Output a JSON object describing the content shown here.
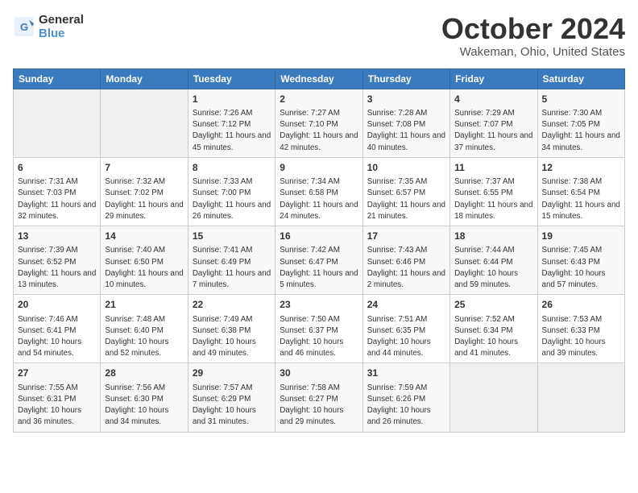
{
  "header": {
    "logo_line1": "General",
    "logo_line2": "Blue",
    "month_title": "October 2024",
    "location": "Wakeman, Ohio, United States"
  },
  "weekdays": [
    "Sunday",
    "Monday",
    "Tuesday",
    "Wednesday",
    "Thursday",
    "Friday",
    "Saturday"
  ],
  "weeks": [
    [
      {
        "day": "",
        "info": ""
      },
      {
        "day": "",
        "info": ""
      },
      {
        "day": "1",
        "info": "Sunrise: 7:26 AM\nSunset: 7:12 PM\nDaylight: 11 hours and 45 minutes."
      },
      {
        "day": "2",
        "info": "Sunrise: 7:27 AM\nSunset: 7:10 PM\nDaylight: 11 hours and 42 minutes."
      },
      {
        "day": "3",
        "info": "Sunrise: 7:28 AM\nSunset: 7:08 PM\nDaylight: 11 hours and 40 minutes."
      },
      {
        "day": "4",
        "info": "Sunrise: 7:29 AM\nSunset: 7:07 PM\nDaylight: 11 hours and 37 minutes."
      },
      {
        "day": "5",
        "info": "Sunrise: 7:30 AM\nSunset: 7:05 PM\nDaylight: 11 hours and 34 minutes."
      }
    ],
    [
      {
        "day": "6",
        "info": "Sunrise: 7:31 AM\nSunset: 7:03 PM\nDaylight: 11 hours and 32 minutes."
      },
      {
        "day": "7",
        "info": "Sunrise: 7:32 AM\nSunset: 7:02 PM\nDaylight: 11 hours and 29 minutes."
      },
      {
        "day": "8",
        "info": "Sunrise: 7:33 AM\nSunset: 7:00 PM\nDaylight: 11 hours and 26 minutes."
      },
      {
        "day": "9",
        "info": "Sunrise: 7:34 AM\nSunset: 6:58 PM\nDaylight: 11 hours and 24 minutes."
      },
      {
        "day": "10",
        "info": "Sunrise: 7:35 AM\nSunset: 6:57 PM\nDaylight: 11 hours and 21 minutes."
      },
      {
        "day": "11",
        "info": "Sunrise: 7:37 AM\nSunset: 6:55 PM\nDaylight: 11 hours and 18 minutes."
      },
      {
        "day": "12",
        "info": "Sunrise: 7:38 AM\nSunset: 6:54 PM\nDaylight: 11 hours and 15 minutes."
      }
    ],
    [
      {
        "day": "13",
        "info": "Sunrise: 7:39 AM\nSunset: 6:52 PM\nDaylight: 11 hours and 13 minutes."
      },
      {
        "day": "14",
        "info": "Sunrise: 7:40 AM\nSunset: 6:50 PM\nDaylight: 11 hours and 10 minutes."
      },
      {
        "day": "15",
        "info": "Sunrise: 7:41 AM\nSunset: 6:49 PM\nDaylight: 11 hours and 7 minutes."
      },
      {
        "day": "16",
        "info": "Sunrise: 7:42 AM\nSunset: 6:47 PM\nDaylight: 11 hours and 5 minutes."
      },
      {
        "day": "17",
        "info": "Sunrise: 7:43 AM\nSunset: 6:46 PM\nDaylight: 11 hours and 2 minutes."
      },
      {
        "day": "18",
        "info": "Sunrise: 7:44 AM\nSunset: 6:44 PM\nDaylight: 10 hours and 59 minutes."
      },
      {
        "day": "19",
        "info": "Sunrise: 7:45 AM\nSunset: 6:43 PM\nDaylight: 10 hours and 57 minutes."
      }
    ],
    [
      {
        "day": "20",
        "info": "Sunrise: 7:46 AM\nSunset: 6:41 PM\nDaylight: 10 hours and 54 minutes."
      },
      {
        "day": "21",
        "info": "Sunrise: 7:48 AM\nSunset: 6:40 PM\nDaylight: 10 hours and 52 minutes."
      },
      {
        "day": "22",
        "info": "Sunrise: 7:49 AM\nSunset: 6:38 PM\nDaylight: 10 hours and 49 minutes."
      },
      {
        "day": "23",
        "info": "Sunrise: 7:50 AM\nSunset: 6:37 PM\nDaylight: 10 hours and 46 minutes."
      },
      {
        "day": "24",
        "info": "Sunrise: 7:51 AM\nSunset: 6:35 PM\nDaylight: 10 hours and 44 minutes."
      },
      {
        "day": "25",
        "info": "Sunrise: 7:52 AM\nSunset: 6:34 PM\nDaylight: 10 hours and 41 minutes."
      },
      {
        "day": "26",
        "info": "Sunrise: 7:53 AM\nSunset: 6:33 PM\nDaylight: 10 hours and 39 minutes."
      }
    ],
    [
      {
        "day": "27",
        "info": "Sunrise: 7:55 AM\nSunset: 6:31 PM\nDaylight: 10 hours and 36 minutes."
      },
      {
        "day": "28",
        "info": "Sunrise: 7:56 AM\nSunset: 6:30 PM\nDaylight: 10 hours and 34 minutes."
      },
      {
        "day": "29",
        "info": "Sunrise: 7:57 AM\nSunset: 6:29 PM\nDaylight: 10 hours and 31 minutes."
      },
      {
        "day": "30",
        "info": "Sunrise: 7:58 AM\nSunset: 6:27 PM\nDaylight: 10 hours and 29 minutes."
      },
      {
        "day": "31",
        "info": "Sunrise: 7:59 AM\nSunset: 6:26 PM\nDaylight: 10 hours and 26 minutes."
      },
      {
        "day": "",
        "info": ""
      },
      {
        "day": "",
        "info": ""
      }
    ]
  ]
}
